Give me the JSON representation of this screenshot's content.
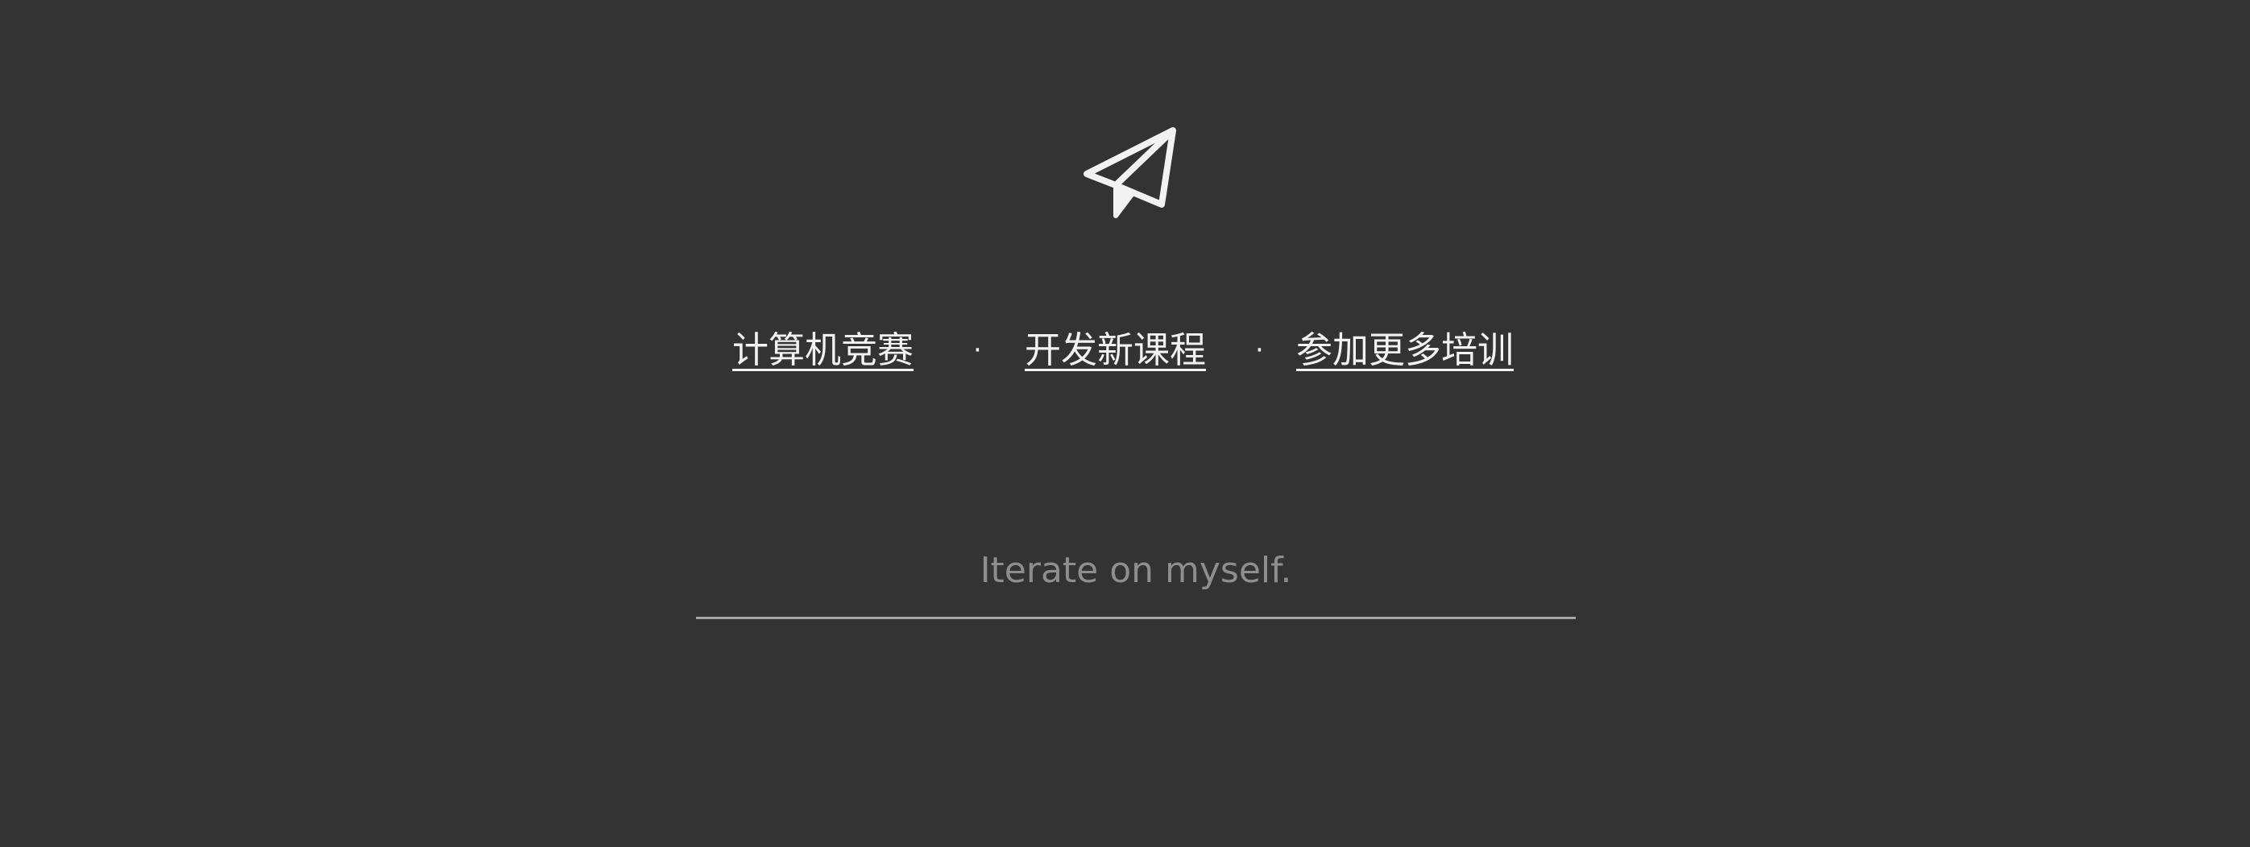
{
  "logo": {
    "icon": "paper-plane-icon",
    "color": "#f2f2f2"
  },
  "nav": {
    "links": [
      {
        "label": "计算机竞赛"
      },
      {
        "label": "开发新课程"
      },
      {
        "label": "参加更多培训"
      }
    ],
    "separator": "·"
  },
  "search": {
    "placeholder": "Iterate on myself.",
    "value": ""
  },
  "colors": {
    "background": "#333333",
    "text": "#f2f2f2",
    "placeholder": "#8e8e8e",
    "underline": "#a6a6a6"
  }
}
